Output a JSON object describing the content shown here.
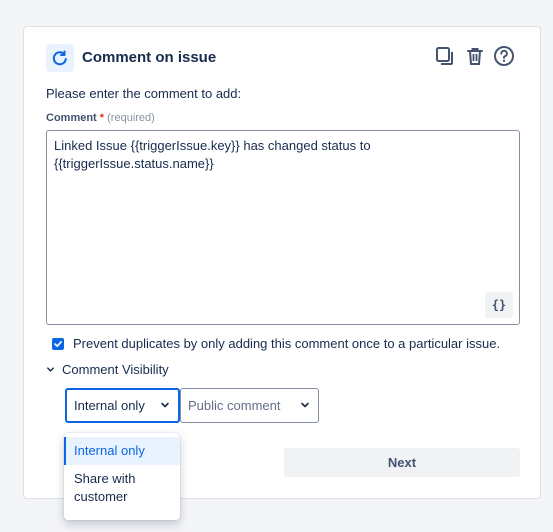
{
  "header": {
    "icon": "comment-refresh-icon",
    "title": "Comment on issue",
    "actions": [
      {
        "name": "duplicate",
        "icon": "copy-icon"
      },
      {
        "name": "delete",
        "icon": "trash-icon"
      },
      {
        "name": "help",
        "icon": "help-icon"
      }
    ]
  },
  "instruction": "Please enter the comment to add:",
  "comment_field": {
    "label": "Comment",
    "required_marker": "*",
    "hint": "(required)",
    "value": "Linked Issue {{triggerIssue.key}} has changed status to {{triggerIssue.status.name}}",
    "smart_value_button": "{}"
  },
  "prevent_duplicates": {
    "checked": true,
    "label": "Prevent duplicates by only adding this comment once to a particular issue."
  },
  "visibility": {
    "label": "Comment Visibility",
    "expanded": true,
    "select_internal": "Internal only",
    "select_public": "Public comment",
    "menu_options": [
      "Internal only",
      "Share with customer"
    ]
  },
  "next_button": "Next",
  "colors": {
    "accent": "#0c66e4",
    "accent_light": "#e9f2ff",
    "required": "#de350b",
    "text": "#172b4d"
  }
}
